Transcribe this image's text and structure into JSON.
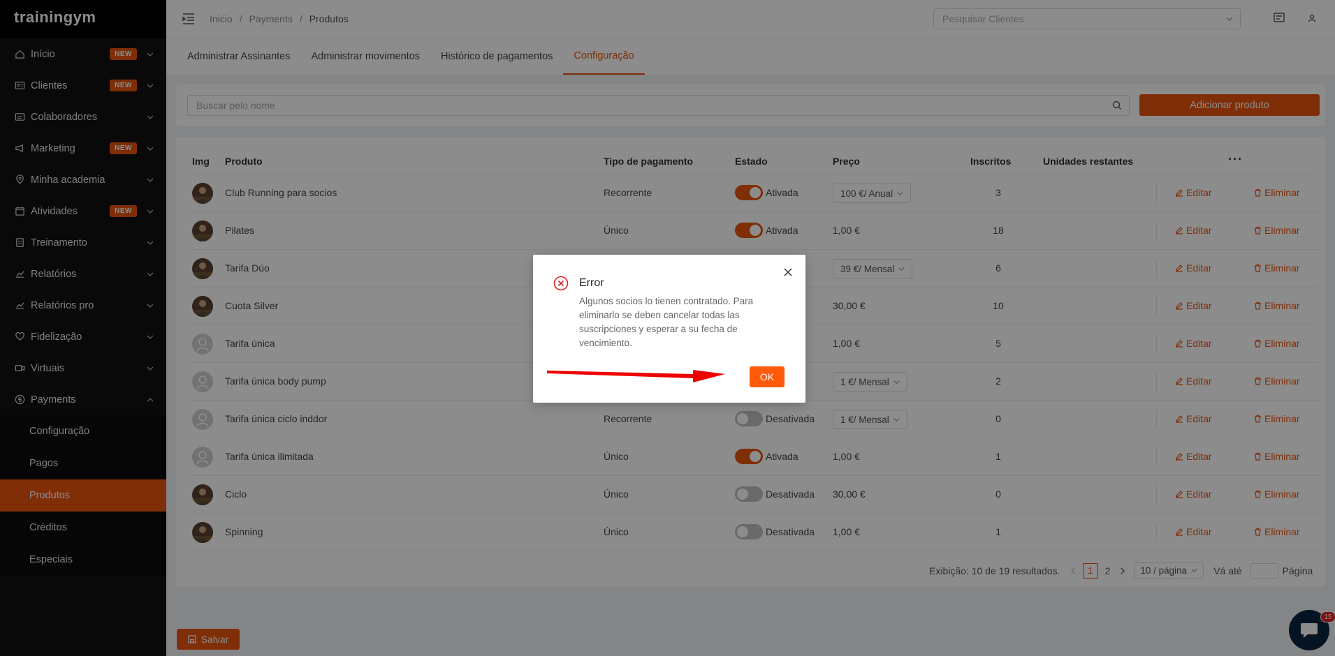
{
  "app": {
    "logo": "trainingym"
  },
  "sidebar": {
    "items": [
      {
        "label": "Início",
        "badge": "NEW",
        "icon": "home-icon"
      },
      {
        "label": "Clientes",
        "badge": "NEW",
        "icon": "id-card-icon"
      },
      {
        "label": "Colaboradores",
        "badge": "",
        "icon": "contacts-icon"
      },
      {
        "label": "Marketing",
        "badge": "NEW",
        "icon": "megaphone-icon"
      },
      {
        "label": "Minha academia",
        "badge": "",
        "icon": "location-pin-icon"
      },
      {
        "label": "Atividades",
        "badge": "NEW",
        "icon": "calendar-icon"
      },
      {
        "label": "Treinamento",
        "badge": "",
        "icon": "clipboard-icon"
      },
      {
        "label": "Relatórios",
        "badge": "",
        "icon": "line-chart-icon"
      },
      {
        "label": "Relatórios pro",
        "badge": "",
        "icon": "line-chart-icon"
      },
      {
        "label": "Fidelização",
        "badge": "",
        "icon": "heart-icon"
      },
      {
        "label": "Virtuais",
        "badge": "",
        "icon": "video-icon"
      },
      {
        "label": "Payments",
        "badge": "",
        "icon": "dollar-icon"
      }
    ],
    "payments_sub": [
      "Configuração",
      "Pagos",
      "Produtos",
      "Créditos",
      "Especiais"
    ]
  },
  "topbar": {
    "breadcrumb": [
      "Inicio",
      "Payments",
      "Produtos"
    ],
    "separator": "/",
    "client_search_placeholder": "Pesquisar Clientes"
  },
  "tabs": [
    "Administrar Assinantes",
    "Administrar movimentos",
    "Histórico de pagamentos",
    "Configuração"
  ],
  "search": {
    "placeholder": "Buscar pelo nome",
    "add_label": "Adicionar produto"
  },
  "table": {
    "headers": {
      "img": "Img",
      "produto": "Produto",
      "tipo": "Tipo de pagamento",
      "estado": "Estado",
      "preco": "Preço",
      "inscritos": "Inscritos",
      "unidades": "Unidades restantes",
      "more": "···"
    },
    "edit_label": "Editar",
    "delete_label": "Eliminar",
    "rows": [
      {
        "name": "Club Running para socios",
        "tipo": "Recorrente",
        "on": true,
        "estado": "Ativada",
        "price": "100 €/ Anual",
        "select": true,
        "inscritos": "3",
        "avatar": "photo"
      },
      {
        "name": "Pilates",
        "tipo": "Único",
        "on": true,
        "estado": "Ativada",
        "price": "1,00 €",
        "select": false,
        "inscritos": "18",
        "avatar": "photo"
      },
      {
        "name": "Tarifa Dúo",
        "tipo": "",
        "on": null,
        "estado": "",
        "price": "39 €/ Mensal",
        "select": true,
        "inscritos": "6",
        "avatar": "photo"
      },
      {
        "name": "Cuota Silver",
        "tipo": "",
        "on": null,
        "estado": "",
        "price": "30,00 €",
        "select": false,
        "inscritos": "10",
        "avatar": "photo"
      },
      {
        "name": "Tarifa única",
        "tipo": "",
        "on": null,
        "estado": "",
        "price": "1,00 €",
        "select": false,
        "inscritos": "5",
        "avatar": "placeholder"
      },
      {
        "name": "Tarifa única body pump",
        "tipo": "",
        "on": null,
        "estado": "",
        "price": "1 €/ Mensal",
        "select": true,
        "inscritos": "2",
        "avatar": "placeholder"
      },
      {
        "name": "Tarifa única ciclo inddor",
        "tipo": "Recorrente",
        "on": false,
        "estado": "Desativada",
        "price": "1 €/ Mensal",
        "select": true,
        "inscritos": "0",
        "avatar": "placeholder"
      },
      {
        "name": "Tarifa única ilimitada",
        "tipo": "Único",
        "on": true,
        "estado": "Ativada",
        "price": "1,00 €",
        "select": false,
        "inscritos": "1",
        "avatar": "placeholder"
      },
      {
        "name": "Ciclo",
        "tipo": "Único",
        "on": false,
        "estado": "Desativada",
        "price": "30,00 €",
        "select": false,
        "inscritos": "0",
        "avatar": "photo"
      },
      {
        "name": "Spinning",
        "tipo": "Único",
        "on": false,
        "estado": "Desativada",
        "price": "1,00 €",
        "select": false,
        "inscritos": "1",
        "avatar": "photo"
      }
    ]
  },
  "pagination": {
    "summary": "Exibição: 10 de 19 resultados.",
    "page1": "1",
    "page2": "2",
    "page_size": "10 / página",
    "goto": "Vá até",
    "page_label": "Página"
  },
  "save_label": "Salvar",
  "chat": {
    "badge": "15"
  },
  "modal": {
    "title": "Error",
    "message": "Algunos socios lo tienen contratado. Para eliminarlo se deben cancelar todas las suscripciones y esperar a su fecha de vencimiento.",
    "ok_label": "OK"
  },
  "colors": {
    "accent": "#e8540f",
    "sidebar_bg": "#121212",
    "error": "#e02020"
  }
}
